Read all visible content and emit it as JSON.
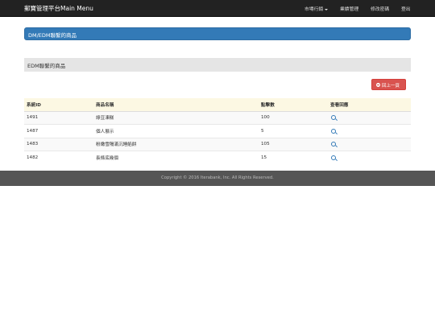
{
  "navbar": {
    "brand": "郵寶管理平台Main Menu",
    "items": [
      {
        "label": "市場行銷"
      },
      {
        "label": "業績管理"
      },
      {
        "label": "修改密碼"
      },
      {
        "label": "登出"
      }
    ]
  },
  "breadcrumb_panel": {
    "title": "DM/EDM聯繫的商品"
  },
  "section": {
    "title": "EDM聯繫的商品"
  },
  "back_button": {
    "label": "回上一頁"
  },
  "table": {
    "headers": [
      "系統ID",
      "商品名稱",
      "點擊數",
      "查看回應"
    ],
    "rows": [
      {
        "id": "1491",
        "name": "綠豆凍糕",
        "clicks": "100"
      },
      {
        "id": "1487",
        "name": "個人展示",
        "clicks": "5"
      },
      {
        "id": "1483",
        "name": "粉嫩雪隔滿沉睡餡餅",
        "clicks": "105"
      },
      {
        "id": "1482",
        "name": "長條底幾個",
        "clicks": "15"
      }
    ]
  },
  "footer": {
    "text": "Copyright © 2016 Iterabank, Inc. All Rights Reserved."
  },
  "colors": {
    "navbar": "#222222",
    "primary": "#337ab7",
    "danger": "#d9534f",
    "table_header": "#fcf8e3",
    "footer": "#555555"
  }
}
